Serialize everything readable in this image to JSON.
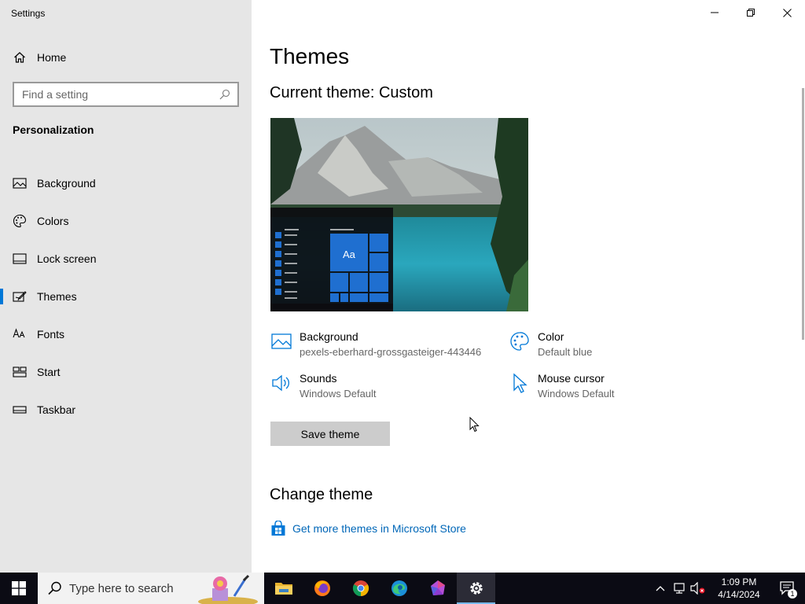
{
  "window": {
    "title": "Settings",
    "controls": [
      "minimize",
      "restore",
      "close"
    ]
  },
  "sidebar": {
    "home_label": "Home",
    "search_placeholder": "Find a setting",
    "section_title": "Personalization",
    "items": [
      {
        "label": "Background",
        "icon": "image-icon",
        "active": false
      },
      {
        "label": "Colors",
        "icon": "palette-icon",
        "active": false
      },
      {
        "label": "Lock screen",
        "icon": "lock-screen-icon",
        "active": false
      },
      {
        "label": "Themes",
        "icon": "themes-icon",
        "active": true
      },
      {
        "label": "Fonts",
        "icon": "fonts-icon",
        "active": false
      },
      {
        "label": "Start",
        "icon": "start-icon",
        "active": false
      },
      {
        "label": "Taskbar",
        "icon": "taskbar-icon",
        "active": false
      }
    ]
  },
  "main": {
    "page_title": "Themes",
    "current_theme": "Current theme: Custom",
    "preview": {
      "tile_text": "Aa"
    },
    "properties": {
      "background": {
        "title": "Background",
        "value": "pexels-eberhard-grossgasteiger-443446"
      },
      "color": {
        "title": "Color",
        "value": "Default blue"
      },
      "sounds": {
        "title": "Sounds",
        "value": "Windows Default"
      },
      "mouse_cursor": {
        "title": "Mouse cursor",
        "value": "Windows Default"
      }
    },
    "save_button": "Save theme",
    "change_theme_title": "Change theme",
    "store_link": "Get more themes in Microsoft Store"
  },
  "taskbar": {
    "search_placeholder": "Type here to search",
    "apps": [
      {
        "name": "file-explorer-icon",
        "active": false
      },
      {
        "name": "firefox-icon",
        "active": false
      },
      {
        "name": "chrome-icon",
        "active": false
      },
      {
        "name": "edge-icon",
        "active": false
      },
      {
        "name": "gem-app-icon",
        "active": false
      },
      {
        "name": "settings-icon",
        "active": true
      }
    ],
    "clock": {
      "time": "1:09 PM",
      "date": "4/14/2024"
    },
    "notification_count": "1"
  },
  "colors": {
    "accent": "#0078d7",
    "sidebar_bg": "#e6e6e6",
    "taskbar_bg": "#0b0b14",
    "link": "#0067b8"
  }
}
